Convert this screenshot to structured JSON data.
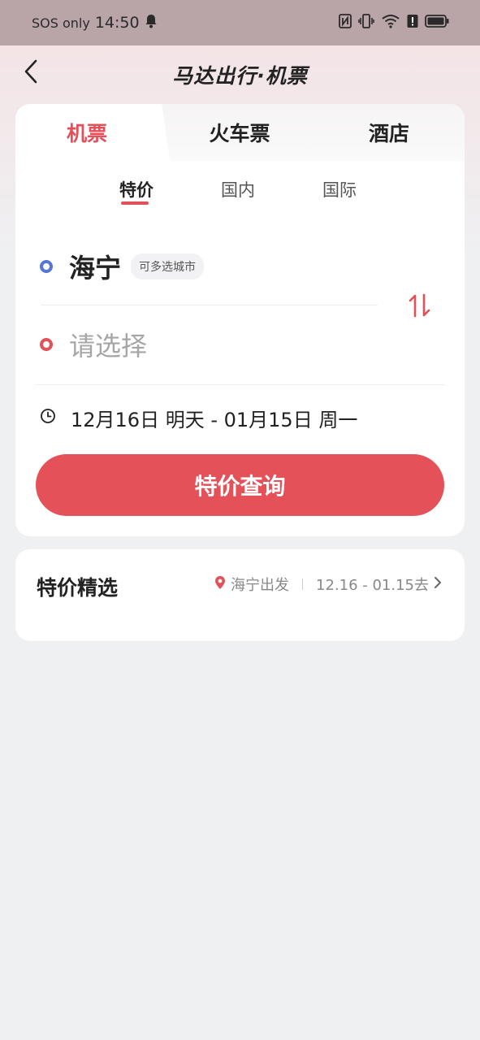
{
  "status_bar": {
    "carrier": "SOS only",
    "time": "14:50",
    "icons": [
      "bell-icon",
      "nfc-icon",
      "vibrate-icon",
      "wifi-icon",
      "alert-icon",
      "battery-icon"
    ]
  },
  "nav": {
    "title": "马达出行·机票",
    "back_icon": "chevron-left-icon"
  },
  "tabs": [
    {
      "label": "机票",
      "active": true
    },
    {
      "label": "火车票",
      "active": false
    },
    {
      "label": "酒店",
      "active": false
    }
  ],
  "sub_tabs": [
    {
      "label": "特价",
      "active": true
    },
    {
      "label": "国内",
      "active": false
    },
    {
      "label": "国际",
      "active": false
    }
  ],
  "route": {
    "from_city": "海宁",
    "multi_city_tag": "可多选城市",
    "to_placeholder": "请选择",
    "swap_icon": "swap-arrows-icon"
  },
  "date": {
    "text": "12月16日 明天 - 01月15日 周一",
    "icon": "clock-icon"
  },
  "search_button": "特价查询",
  "deals": {
    "title": "特价精选",
    "origin": "海宁出发",
    "date_range": "12.16 - 01.15去"
  },
  "colors": {
    "accent": "#e4505a",
    "blue_dot": "#5476d6",
    "page_bg": "#eff0f2",
    "status_bar_bg": "#b9a5a7"
  }
}
